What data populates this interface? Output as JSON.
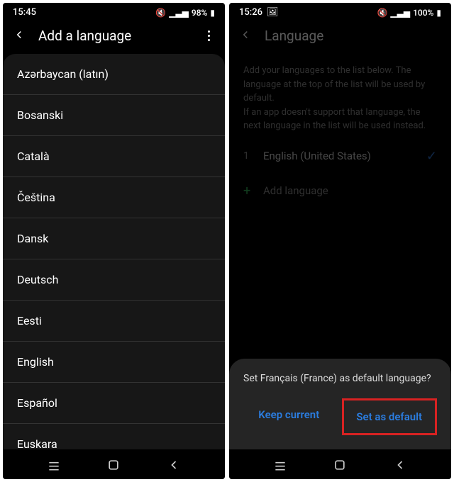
{
  "left": {
    "status": {
      "time": "15:45",
      "battery_pct": "98%"
    },
    "header": {
      "title": "Add a language"
    },
    "languages": [
      "Azərbaycan (latın)",
      "Bosanski",
      "Català",
      "Čeština",
      "Dansk",
      "Deutsch",
      "Eesti",
      "English",
      "Español",
      "Euskara"
    ]
  },
  "right": {
    "status": {
      "time": "15:26",
      "battery_pct": "100%"
    },
    "header": {
      "title": "Language"
    },
    "help": {
      "line1": "Add your languages to the list below. The language at the top of the list will be used by default.",
      "line2": "If an app doesn't support that language, the next language in the list will be used instead."
    },
    "selected": {
      "index": "1",
      "name": "English (United States)"
    },
    "add_label": "Add language",
    "dialog": {
      "prompt": "Set Français (France) as default language?",
      "keep": "Keep current",
      "set": "Set as default"
    }
  }
}
